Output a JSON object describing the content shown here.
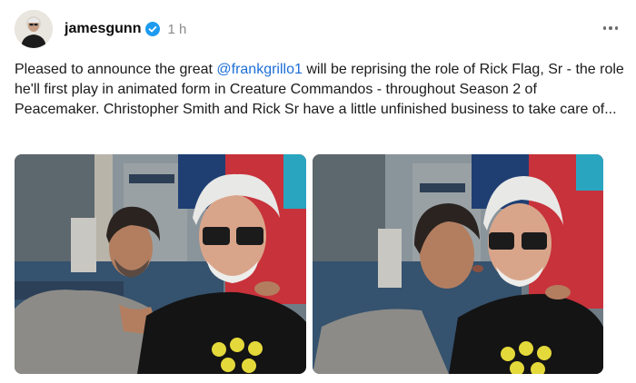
{
  "post": {
    "author": {
      "username": "jamesgunn",
      "verified": true,
      "avatar_icon": "profile-photo"
    },
    "timestamp": "1 h",
    "more_icon": "more-horizontal-icon",
    "caption": {
      "before_mention": "Pleased to announce the great ",
      "mention": "@frankgrillo1",
      "after_mention": " will be reprising the role of Rick Flag, Sr - the role he'll first play in animated form in Creature Commandos - throughout Season 2 of Peacemaker. Christopher Smith and Rick Sr have a little unfinished business to take care of..."
    },
    "media": [
      {
        "type": "photo",
        "description_icon": "selfie-photo"
      },
      {
        "type": "photo",
        "description_icon": "selfie-photo-kiss"
      }
    ],
    "colors": {
      "mention": "#1d6fd8",
      "verified_badge": "#1d9bf0",
      "timestamp": "#8a8a8a"
    }
  }
}
